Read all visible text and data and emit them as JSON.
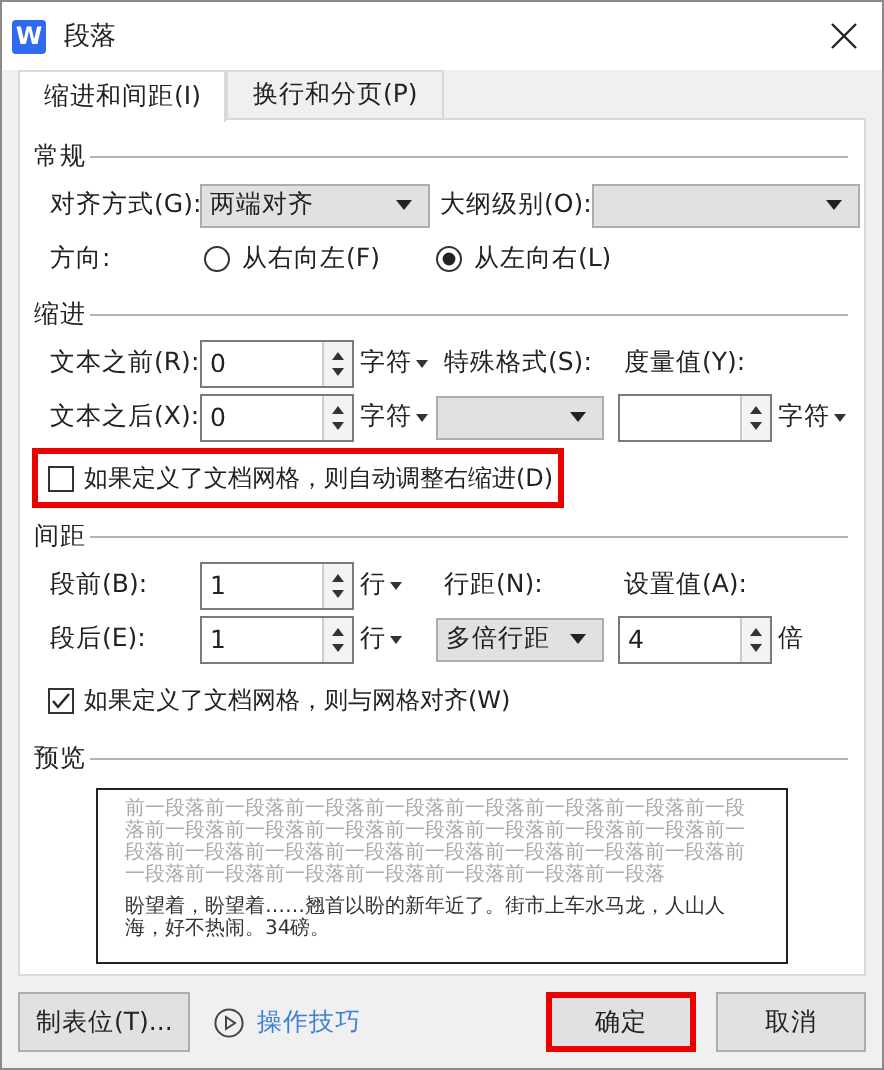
{
  "window": {
    "title": "段落",
    "app_icon": "W"
  },
  "tabs": [
    {
      "label": "缩进和间距(I)",
      "selected": true
    },
    {
      "label": "换行和分页(P)",
      "selected": false
    }
  ],
  "general": {
    "title": "常规",
    "alignment": {
      "label": "对齐方式(G):",
      "value": "两端对齐"
    },
    "outline_level": {
      "label": "大纲级别(O):"
    },
    "direction": {
      "label": "方向:",
      "options": [
        {
          "label": "从右向左(F)",
          "selected": false
        },
        {
          "label": "从左向右(L)",
          "selected": true
        }
      ]
    }
  },
  "indent": {
    "title": "缩进",
    "before": {
      "label": "文本之前(R):",
      "value": "0",
      "unit": "字符"
    },
    "after": {
      "label": "文本之后(X):",
      "value": "0",
      "unit": "字符"
    },
    "special": {
      "label": "特殊格式(S):"
    },
    "measure": {
      "label": "度量值(Y):",
      "unit": "字符"
    },
    "auto_adjust": {
      "label": "如果定义了文档网格，则自动调整右缩进(D)",
      "checked": false,
      "highlighted": true
    }
  },
  "spacing": {
    "title": "间距",
    "before": {
      "label": "段前(B):",
      "value": "1",
      "unit": "行"
    },
    "after": {
      "label": "段后(E):",
      "value": "1",
      "unit": "行"
    },
    "line_spacing": {
      "label": "行距(N):",
      "value": "多倍行距"
    },
    "set_value": {
      "label": "设置值(A):",
      "value": "4",
      "unit": "倍"
    },
    "snap_to_grid": {
      "label": "如果定义了文档网格，则与网格对齐(W)",
      "checked": true,
      "highlighted": false
    }
  },
  "preview": {
    "title": "预览",
    "previous_text": "前一段落前一段落前一段落前一段落前一段落前一段落前一段落前一段落前一段落前一段落前一段落前一段落前一段落前一段落前一段落前一段落前一段落前一段落前一段落前一段落前一段落前一段落前一段落前一段落前一段落前一段落前一段落前一段落前一段落前一段落",
    "sample_text": "盼望着，盼望着……翘首以盼的新年近了。街市上车水马龙，人山人海，好不热闹。34磅。"
  },
  "buttons": [
    {
      "label": "制表位(T)...",
      "kind": "button",
      "highlighted": false
    },
    {
      "label": "操作技巧",
      "kind": "link",
      "highlighted": false
    },
    {
      "label": "确定",
      "kind": "button",
      "highlighted": true
    },
    {
      "label": "取消",
      "kind": "button",
      "highlighted": false
    }
  ]
}
